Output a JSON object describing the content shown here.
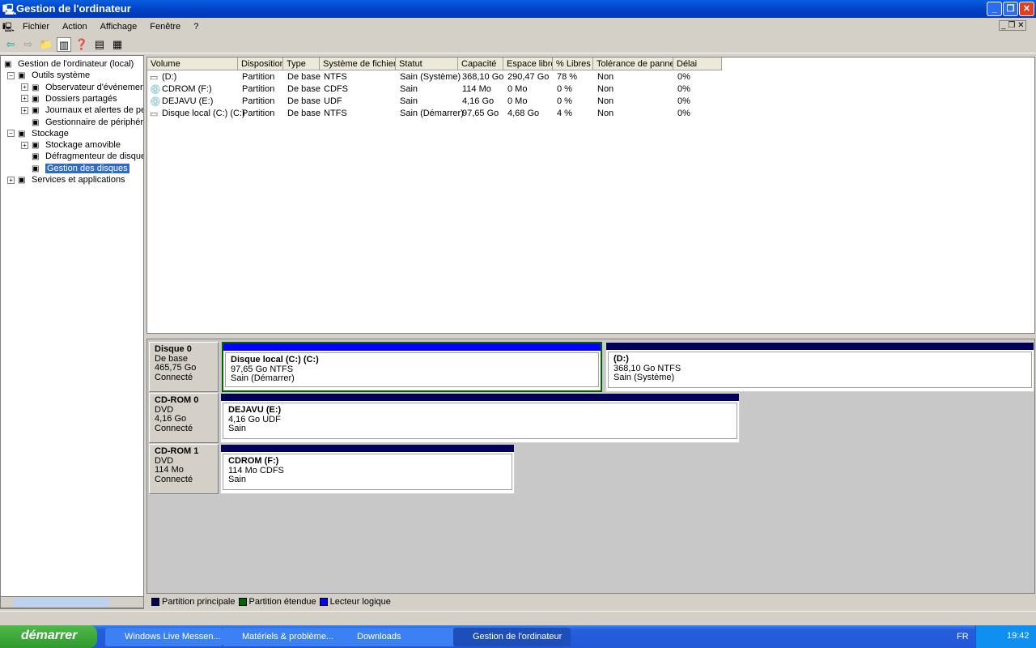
{
  "window": {
    "title": "Gestion de l'ordinateur"
  },
  "menu": [
    "Fichier",
    "Action",
    "Affichage",
    "Fenêtre",
    "?"
  ],
  "tree": [
    {
      "label": "Gestion de l'ordinateur (local)",
      "level": 0,
      "exp": ""
    },
    {
      "label": "Outils système",
      "level": 1,
      "exp": "−"
    },
    {
      "label": "Observateur d'événements",
      "level": 2,
      "exp": "+"
    },
    {
      "label": "Dossiers partagés",
      "level": 2,
      "exp": "+"
    },
    {
      "label": "Journaux et alertes de perfo",
      "level": 2,
      "exp": "+"
    },
    {
      "label": "Gestionnaire de périphérique",
      "level": 2,
      "exp": ""
    },
    {
      "label": "Stockage",
      "level": 1,
      "exp": "−"
    },
    {
      "label": "Stockage amovible",
      "level": 2,
      "exp": "+"
    },
    {
      "label": "Défragmenteur de disque",
      "level": 2,
      "exp": ""
    },
    {
      "label": "Gestion des disques",
      "level": 2,
      "exp": "",
      "selected": true
    },
    {
      "label": "Services et applications",
      "level": 1,
      "exp": "+"
    }
  ],
  "columns": [
    "Volume",
    "Disposition",
    "Type",
    "Système de fichiers",
    "Statut",
    "Capacité",
    "Espace libre",
    "% Libres",
    "Tolérance de pannes",
    "Délai"
  ],
  "rows": [
    [
      "(D:)",
      "Partition",
      "De base",
      "NTFS",
      "Sain (Système)",
      "368,10 Go",
      "290,47 Go",
      "78 %",
      "Non",
      "0%"
    ],
    [
      "CDROM (F:)",
      "Partition",
      "De base",
      "CDFS",
      "Sain",
      "114 Mo",
      "0 Mo",
      "0 %",
      "Non",
      "0%"
    ],
    [
      "DEJAVU (E:)",
      "Partition",
      "De base",
      "UDF",
      "Sain",
      "4,16 Go",
      "0 Mo",
      "0 %",
      "Non",
      "0%"
    ],
    [
      "Disque local (C:) (C:)",
      "Partition",
      "De base",
      "NTFS",
      "Sain (Démarrer)",
      "97,65 Go",
      "4,68 Go",
      "4 %",
      "Non",
      "0%"
    ]
  ],
  "row_icons": [
    "hdd",
    "cd",
    "cd",
    "hdd"
  ],
  "disks": [
    {
      "name": "Disque 0",
      "type": "De base",
      "size": "465,75 Go",
      "state": "Connecté",
      "parts": [
        {
          "title": "Disque local (C:)  (C:)",
          "size": "97,65 Go NTFS",
          "status": "Sain (Démarrer)"
        },
        {
          "title": "(D:)",
          "size": "368,10 Go NTFS",
          "status": "Sain (Système)"
        }
      ]
    },
    {
      "name": "CD-ROM 0",
      "type": "DVD",
      "size": "4,16 Go",
      "state": "Connecté",
      "parts": [
        {
          "title": "DEJAVU  (E:)",
          "size": "4,16 Go UDF",
          "status": "Sain"
        }
      ]
    },
    {
      "name": "CD-ROM 1",
      "type": "DVD",
      "size": "114 Mo",
      "state": "Connecté",
      "parts": [
        {
          "title": "CDROM  (F:)",
          "size": "114 Mo CDFS",
          "status": "Sain"
        }
      ]
    }
  ],
  "legend": [
    {
      "label": "Partition principale",
      "color": "#00005a"
    },
    {
      "label": "Partition étendue",
      "color": "#006400"
    },
    {
      "label": "Lecteur logique",
      "color": "#0000ff"
    }
  ],
  "taskbar": {
    "start": "démarrer",
    "tasks": [
      "Windows Live Messen...",
      "Matériels & problème...",
      "Downloads",
      "Gestion de l'ordinateur"
    ],
    "lang": "FR",
    "clock": "19:42"
  }
}
